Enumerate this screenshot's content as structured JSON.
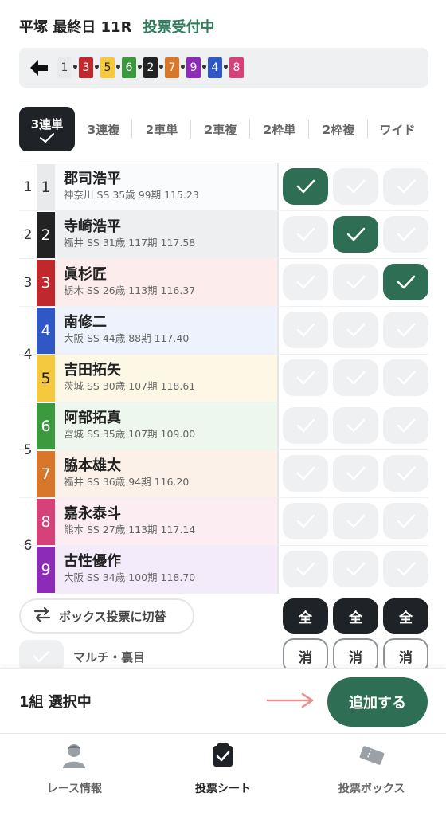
{
  "header": {
    "title": "平塚 最終日 11R",
    "status": "投票受付中"
  },
  "lineup": {
    "cars": [
      {
        "num": "1",
        "bg": "#e8eaec",
        "fg": "#444444"
      },
      {
        "num": "3",
        "bg": "#c0282d",
        "fg": "#ffffff"
      },
      {
        "num": "5",
        "bg": "#f5c93d",
        "fg": "#222222"
      },
      {
        "num": "6",
        "bg": "#3c9a3e",
        "fg": "#ffffff"
      },
      {
        "num": "2",
        "bg": "#232323",
        "fg": "#ffffff"
      },
      {
        "num": "7",
        "bg": "#d8762a",
        "fg": "#ffffff"
      },
      {
        "num": "9",
        "bg": "#8b2bb8",
        "fg": "#ffffff"
      },
      {
        "num": "4",
        "bg": "#2f58c4",
        "fg": "#ffffff"
      },
      {
        "num": "8",
        "bg": "#d6417a",
        "fg": "#ffffff"
      }
    ]
  },
  "tabs": [
    {
      "label": "3連単",
      "active": true
    },
    {
      "label": "3連複"
    },
    {
      "label": "2車単"
    },
    {
      "label": "2車複"
    },
    {
      "label": "2枠単"
    },
    {
      "label": "2枠複"
    },
    {
      "label": "ワイド"
    }
  ],
  "frames": [
    {
      "label": "1",
      "rows": 1
    },
    {
      "label": "2",
      "rows": 1
    },
    {
      "label": "3",
      "rows": 1
    },
    {
      "label": "4",
      "rows": 2
    },
    {
      "label": "5",
      "rows": 2
    },
    {
      "label": "6",
      "rows": 2
    }
  ],
  "riders": [
    {
      "car": "1",
      "name": "郡司浩平",
      "detail": "神奈川 SS 35歳 99期 115.23",
      "color": "#e8eaec",
      "textColor": "#333333",
      "rowBg": "#fafbfc",
      "checks": [
        true,
        false,
        false
      ]
    },
    {
      "car": "2",
      "name": "寺崎浩平",
      "detail": "福井 SS 31歳 117期 117.58",
      "color": "#232323",
      "textColor": "#ffffff",
      "rowBg": "#eeeff1",
      "checks": [
        false,
        true,
        false
      ]
    },
    {
      "car": "3",
      "name": "眞杉匠",
      "detail": "栃木 SS 26歳 113期 116.37",
      "color": "#c0282d",
      "textColor": "#ffffff",
      "rowBg": "#fcecec",
      "checks": [
        false,
        false,
        true
      ]
    },
    {
      "car": "4",
      "name": "南修二",
      "detail": "大阪 SS 44歳 88期 117.40",
      "color": "#2f58c4",
      "textColor": "#ffffff",
      "rowBg": "#edf2fc",
      "checks": [
        false,
        false,
        false
      ]
    },
    {
      "car": "5",
      "name": "吉田拓矢",
      "detail": "茨城 SS 30歳 107期 118.61",
      "color": "#f5c93d",
      "textColor": "#222222",
      "rowBg": "#fdf8e6",
      "checks": [
        false,
        false,
        false
      ]
    },
    {
      "car": "6",
      "name": "阿部拓真",
      "detail": "宮城 SS 35歳 107期 109.00",
      "color": "#3c9a3e",
      "textColor": "#ffffff",
      "rowBg": "#edf7ed",
      "checks": [
        false,
        false,
        false
      ]
    },
    {
      "car": "7",
      "name": "脇本雄太",
      "detail": "福井 SS 36歳 94期 116.20",
      "color": "#d8762a",
      "textColor": "#ffffff",
      "rowBg": "#fcf1e8",
      "checks": [
        false,
        false,
        false
      ]
    },
    {
      "car": "8",
      "name": "嘉永泰斗",
      "detail": "熊本 SS 27歳 113期 117.14",
      "color": "#d6417a",
      "textColor": "#ffffff",
      "rowBg": "#fcedf3",
      "checks": [
        false,
        false,
        false
      ]
    },
    {
      "car": "9",
      "name": "古性優作",
      "detail": "大阪 SS 34歳 100期 118.70",
      "color": "#8b2bb8",
      "textColor": "#ffffff",
      "rowBg": "#f3ebf9",
      "checks": [
        false,
        false,
        false
      ]
    }
  ],
  "controls": {
    "box_toggle_label": "ボックス投票に切替",
    "multi_label": "マルチ・裏目",
    "all_label": "全",
    "clear_label": "消"
  },
  "footer": {
    "count_label": "1組 選択中",
    "add_label": "追加する"
  },
  "nav": [
    {
      "label": "レース情報",
      "icon": "person-icon"
    },
    {
      "label": "投票シート",
      "icon": "checkbox-icon",
      "active": true
    },
    {
      "label": "投票ボックス",
      "icon": "ticket-icon"
    }
  ],
  "colors": {
    "accent": "#2e6e55",
    "dark": "#1f2226",
    "checkOff": "#eef0f2"
  }
}
